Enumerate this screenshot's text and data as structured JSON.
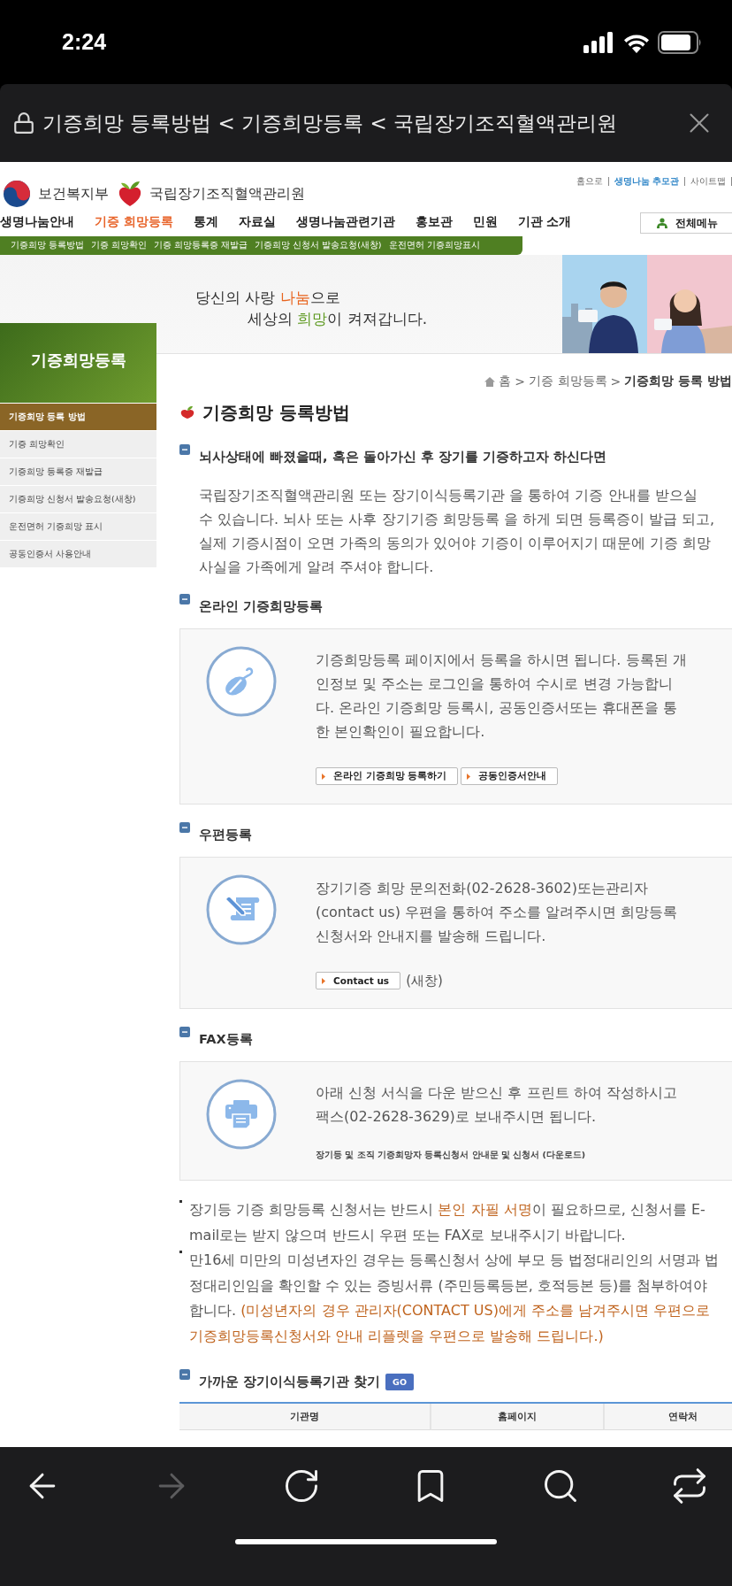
{
  "status_bar": {
    "time": "2:24"
  },
  "browser": {
    "title": "기증희망 등록방법 < 기증희망등록 < 국립장기조직혈액관리원",
    "toolbar": [
      {
        "kind": "back",
        "disabled": false
      },
      {
        "kind": "forward",
        "disabled": true
      },
      {
        "kind": "reload",
        "disabled": false
      },
      {
        "kind": "bookmarks",
        "disabled": false
      },
      {
        "kind": "search",
        "disabled": false
      },
      {
        "kind": "tabs",
        "disabled": false
      }
    ]
  },
  "site_header": {
    "ministry": "보건복지부",
    "agency": "국립장기조직혈액관리원",
    "top_links": [
      {
        "label": "홈으로",
        "highlight": false
      },
      {
        "label": "생명나눔 추모관",
        "highlight": true
      },
      {
        "label": "사이트맵",
        "highlight": false
      }
    ],
    "all_menu": "전체메뉴"
  },
  "nav": [
    {
      "label": "생명나눔안내",
      "selected": false
    },
    {
      "label": "기증 희망등록",
      "selected": true
    },
    {
      "label": "통계",
      "selected": false
    },
    {
      "label": "자료실",
      "selected": false
    },
    {
      "label": "생명나눔관련기관",
      "selected": false
    },
    {
      "label": "홍보관",
      "selected": false
    },
    {
      "label": "민원",
      "selected": false
    },
    {
      "label": "기관 소개",
      "selected": false
    }
  ],
  "sub_nav": [
    "기증희망 등록방법",
    "기증 희망확인",
    "기증 희망등록증 재발급",
    "기증희망 신청서 발송요청(새창)",
    "운전면허 기증희망표시"
  ],
  "banner": {
    "lines": [
      [
        {
          "text": "당신의 사랑 "
        },
        {
          "text": "나눔",
          "color": "#e8641e"
        },
        {
          "text": "으로"
        }
      ],
      [
        {
          "text": "세상의 "
        },
        {
          "text": "희망",
          "color": "#5f9a22"
        },
        {
          "text": "이 켜져갑니다."
        }
      ]
    ],
    "photo": {
      "kind": "picture"
    }
  },
  "sidebar": {
    "title": "기증희망등록",
    "items": [
      {
        "label": "기증희망 등록 방법",
        "selected": true
      },
      {
        "label": "기증 희망확인",
        "selected": false
      },
      {
        "label": "기증희망 등록증 재발급",
        "selected": false
      },
      {
        "label": "기증희망 신청서 발송요청(새창)",
        "selected": false
      },
      {
        "label": "운전면허 기증희망 표시",
        "selected": false
      },
      {
        "label": "공동인증서 사용안내",
        "selected": false
      }
    ]
  },
  "breadcrumb": {
    "separator": ">",
    "items": [
      "홈",
      "기증 희망등록",
      "기증희망 등록 방법"
    ]
  },
  "page_title": "기증희망 등록방법",
  "sections": [
    {
      "kind": "text",
      "heading": "뇌사상태에 빠졌을때, 혹은 돌아가신 후 장기를 기증하고자 하신다면",
      "text": "국립장기조직혈액관리원 또는 장기이식등록기관 을 통하여 기증 안내를 받으실 수 있습니다. 뇌사 또는 사후 장기기증 희망등록 을 하게 되면 등록증이 발급 되고, 실제 기증시점이 오면 가족의 동의가 있어야 기증이 이루어지기 때문에 기증 희망 사실을 가족에게 알려 주셔야 합니다."
    },
    {
      "kind": "box",
      "heading": "온라인 기증희망등록",
      "text": "기증희망등록 페이지에서 등록을 하시면 됩니다. 등록된 개인정보 및 주소는 로그인을 통하여 수시로 변경 가능합니다. 온라인 기증희망 등록시, 공동인증서또는 휴대폰을 통한 본인확인이 필요합니다.",
      "actions": [
        {
          "kind": "button",
          "label": "온라인 기증희망 등록하기"
        },
        {
          "kind": "button",
          "label": "공동인증서안내"
        }
      ]
    },
    {
      "kind": "box",
      "heading": "우편등록",
      "text": "장기기증 희망 문의전화(02-2628-3602)또는관리자(contact us) 우편을 통하여 주소를 알려주시면 희망등록신청서와 안내지를 발송해 드립니다.",
      "actions": [
        {
          "kind": "button",
          "label": "Contact us"
        },
        {
          "kind": "note",
          "label": "(새창)"
        }
      ]
    },
    {
      "kind": "box",
      "heading": "FAX등록",
      "text": "아래 신청 서식을 다운 받으신 후 프린트 하여 작성하시고 팩스(02-2628-3629)로 보내주시면 됩니다.",
      "actions": [
        {
          "kind": "link",
          "label": "장기등 및 조직 기증희망자 등록신청서 안내문 및 신청서 (다운로드)"
        }
      ]
    }
  ],
  "notes": [
    [
      {
        "text": "장기등 기증 희망등록 신청서는 반드시 "
      },
      {
        "text": "본인 자필 서명",
        "color": "#c0641e"
      },
      {
        "text": "이 필요하므로, 신청서를 E-mail로는 받지 않으며 반드시 우편 또는 FAX로 보내주시기 바랍니다."
      }
    ],
    [
      {
        "text": "만16세 미만의 미성년자인 경우는 등록신청서 상에 부모 등 법정대리인의 서명과 법정대리인임을 확인할 수 있는 증빙서류 (주민등록등본, 호적등본 등)를 첨부하여야 합니다. "
      },
      {
        "text": "(미성년자의 경우 관리자(CONTACT US)에게 주소를 남겨주시면 우편으로 기증희망등록신청서와 안내 리플렛을 우편으로 발송해 드립니다.)",
        "color": "#c0641e"
      }
    ]
  ],
  "finder": {
    "heading": "가까운 장기이식등록기관 찾기",
    "go": "GO",
    "columns": [
      "기관명",
      "홈페이지",
      "연락처"
    ]
  }
}
